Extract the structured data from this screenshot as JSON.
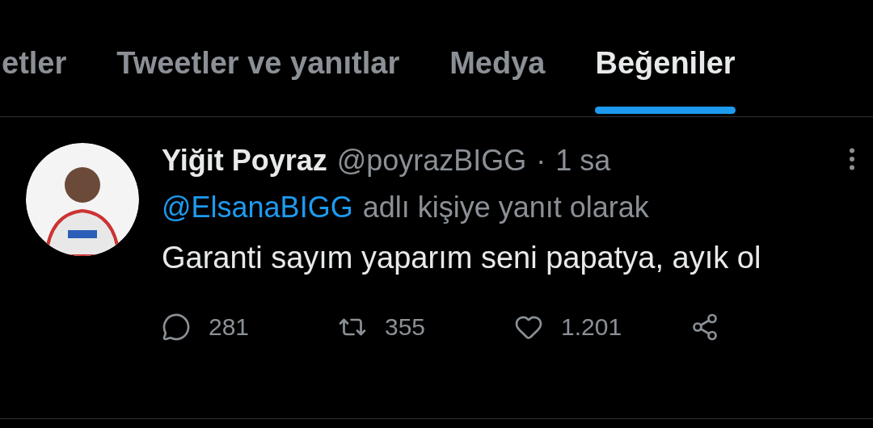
{
  "tabs": [
    {
      "label": "etler",
      "selected": false
    },
    {
      "label": "Tweetler ve yanıtlar",
      "selected": false
    },
    {
      "label": "Medya",
      "selected": false
    },
    {
      "label": "Beğeniler",
      "selected": true
    }
  ],
  "tweet": {
    "author_name": "Yiğit Poyraz",
    "handle": "@poyrazBIGG",
    "separator": "·",
    "time": "1 sa",
    "reply_to": {
      "mention": "@ElsanaBIGG",
      "text": "adlı kişiye yanıt olarak"
    },
    "text": "Garanti sayım yaparım seni papatya, ayık ol",
    "actions": [
      {
        "kind": "reply",
        "count": "281"
      },
      {
        "kind": "retweet",
        "count": "355"
      },
      {
        "kind": "like",
        "count": "1.201"
      },
      {
        "kind": "share"
      }
    ]
  }
}
